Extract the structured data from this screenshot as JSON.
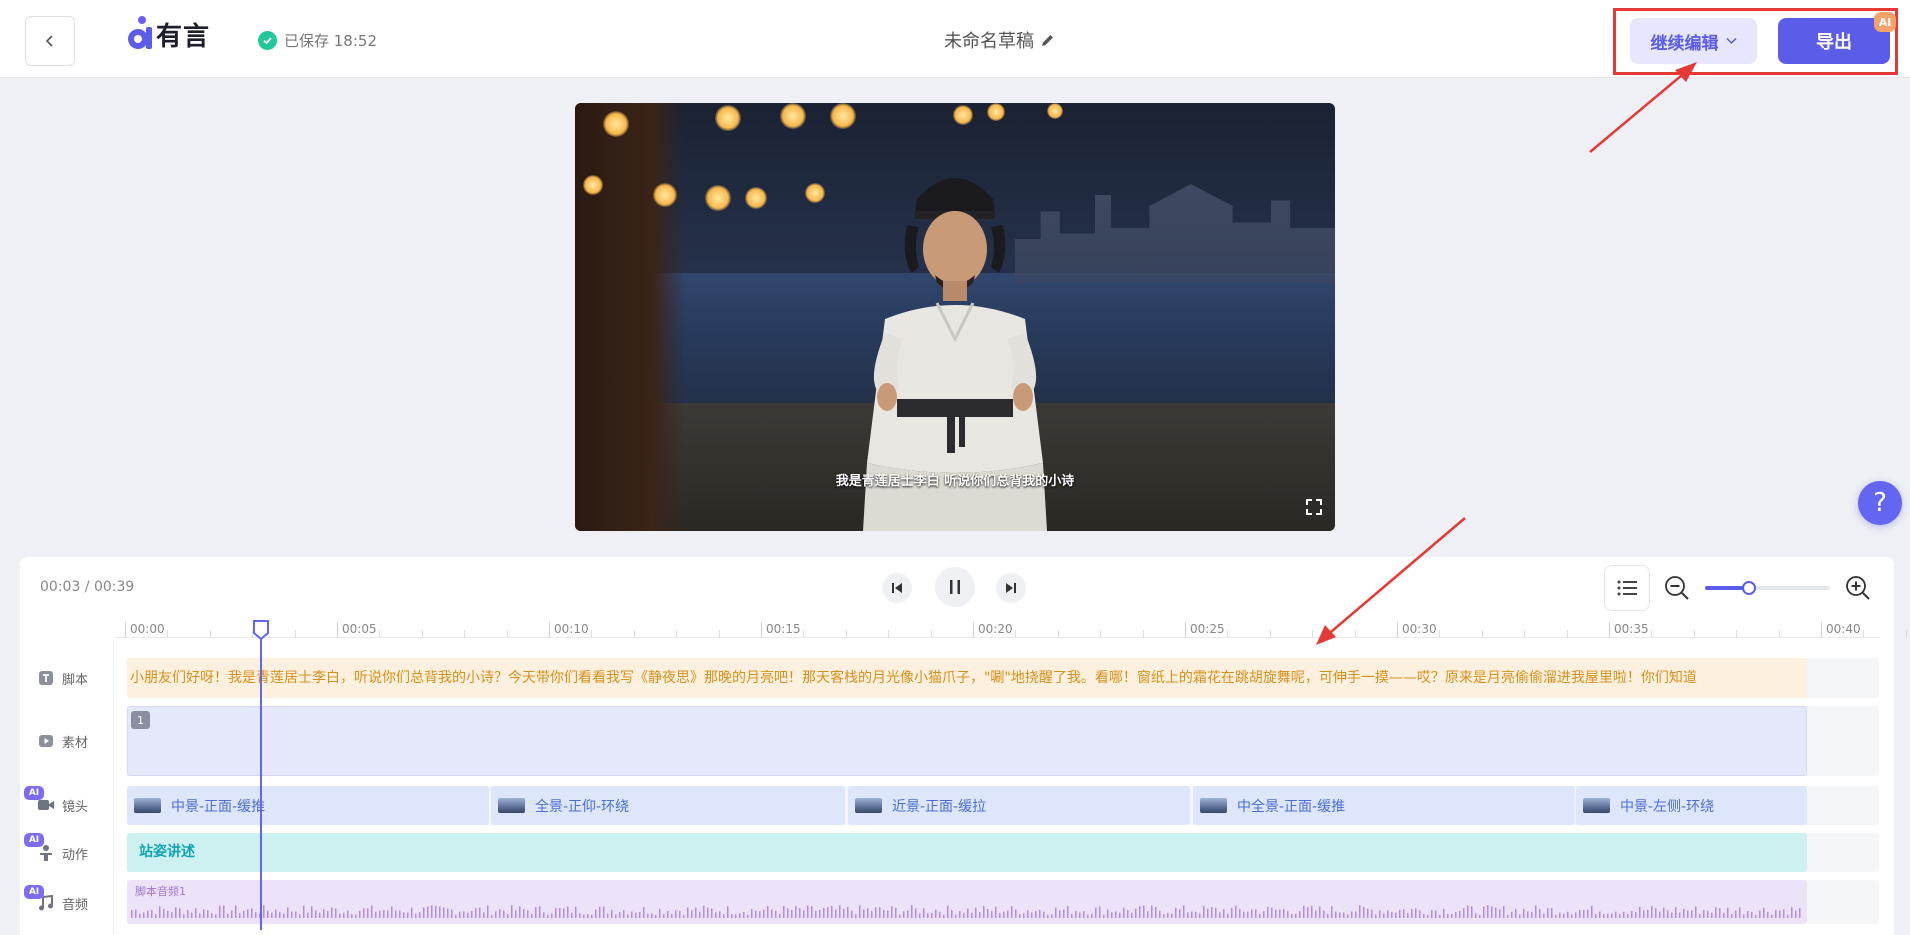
{
  "header": {
    "logo_text": "有言",
    "save_status": "已保存 18:52",
    "doc_title": "未命名草稿",
    "continue_label": "继续编辑",
    "export_label": "导出",
    "ai_badge": "AI"
  },
  "video": {
    "subtitle": "我是青莲居士李白 听说你们总背我的小诗"
  },
  "help": {
    "label": "?"
  },
  "player": {
    "time": "00:03 / 00:39"
  },
  "ruler": {
    "ticks": [
      "00:00",
      "00:05",
      "00:10",
      "00:15",
      "00:20",
      "00:25",
      "00:30",
      "00:35",
      "00:40"
    ]
  },
  "tracks": {
    "script_label": "脚本",
    "material_label": "素材",
    "shot_label": "镜头",
    "action_label": "动作",
    "audio_label": "音频",
    "ai_tag": "AI"
  },
  "script_text": "小朋友们好呀！我是青莲居士李白，听说你们总背我的小诗？今天带你们看看我写《静夜思》那晚的月亮吧！那天客栈的月光像小猫爪子，\"唰\"地挠醒了我。看哪！窗纸上的霜花在跳胡旋舞呢，可伸手一摸——哎？原来是月亮偷偷溜进我屋里啦！你们知道",
  "material_index": "1",
  "shots": [
    "中景-正面-缓推",
    "全景-正仰-环绕",
    "近景-正面-缓拉",
    "中全景-正面-缓推",
    "中景-左侧-环绕"
  ],
  "action_text": "站姿讲述",
  "audio_text": "脚本音频1",
  "zoom_level": 0.35,
  "colors": {
    "accent": "#5b5ce8",
    "annotation": "#e53935"
  }
}
